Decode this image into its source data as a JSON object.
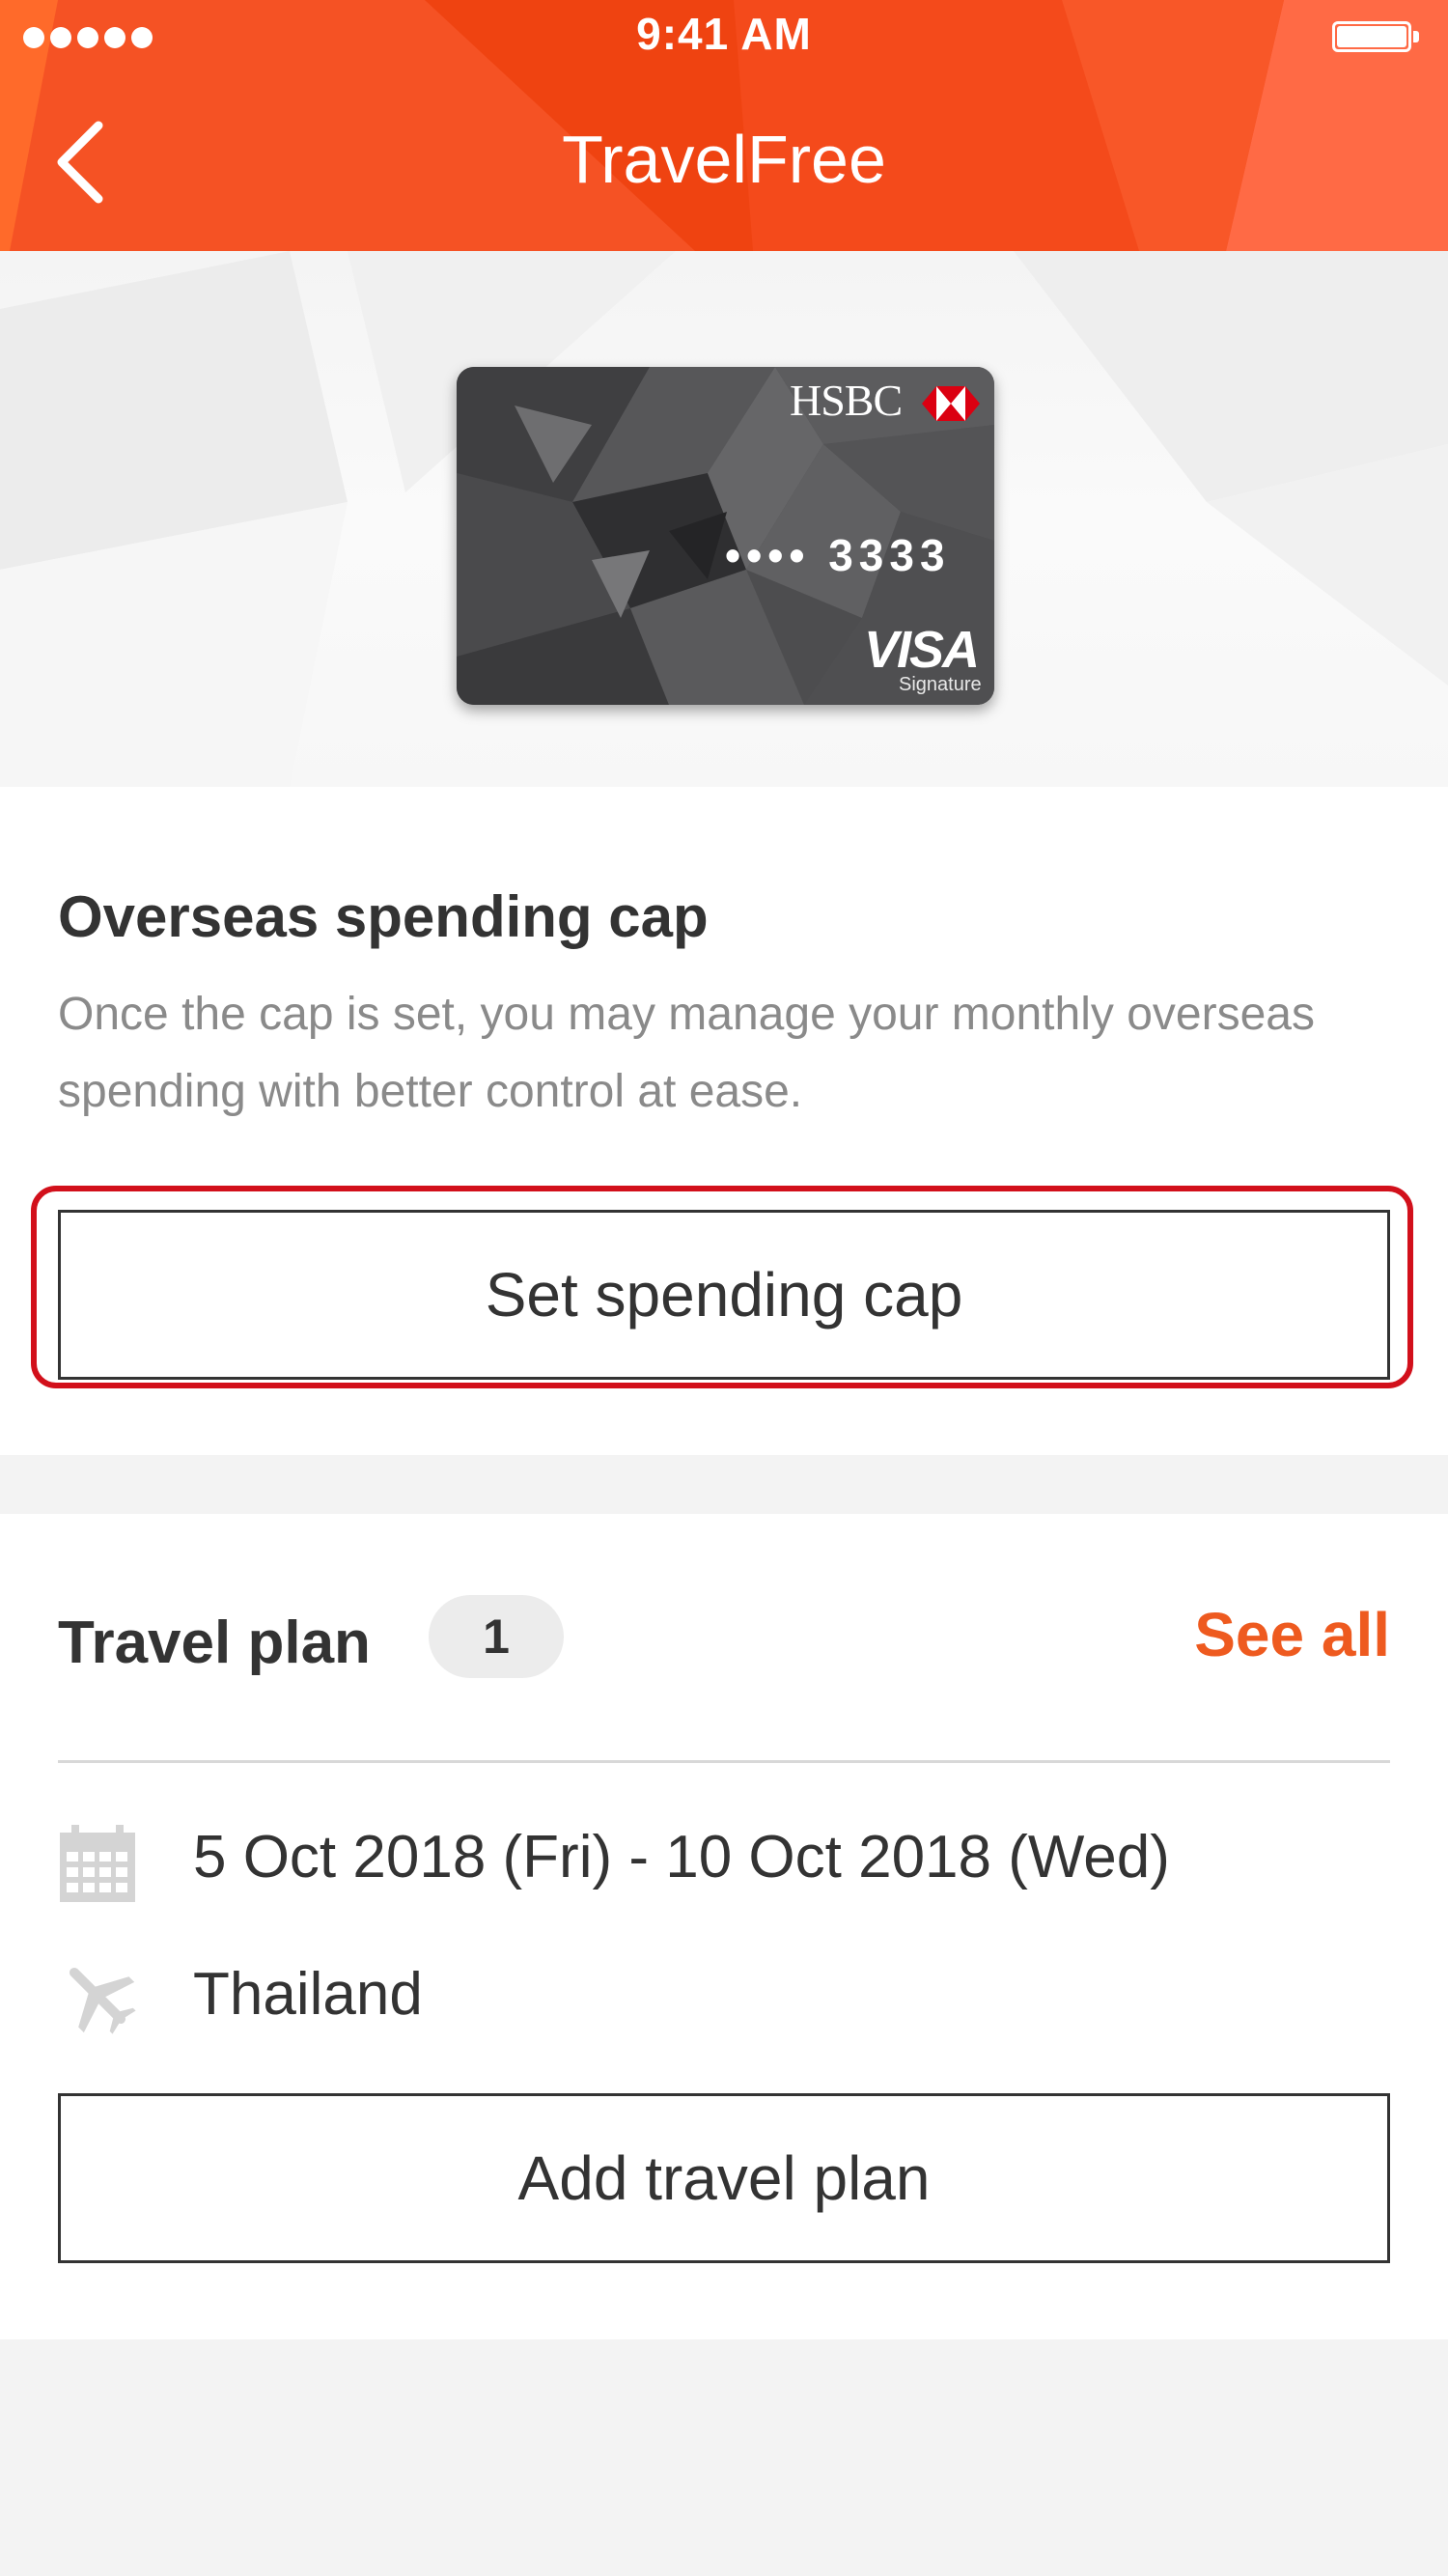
{
  "status_bar": {
    "time": "9:41 AM"
  },
  "nav": {
    "title": "TravelFree"
  },
  "card": {
    "brand": "HSBC",
    "masked_number": "•••• 3333",
    "network": "VISA",
    "tier": "Signature"
  },
  "spending_cap": {
    "title": "Overseas spending cap",
    "description": "Once the cap is set, you may manage your monthly overseas spending with better control at ease.",
    "button_label": "Set spending cap"
  },
  "travel_plan": {
    "title": "Travel plan",
    "count": "1",
    "see_all_label": "See all",
    "dates": "5 Oct 2018 (Fri) - 10 Oct 2018 (Wed)",
    "destination": "Thailand",
    "add_button_label": "Add travel plan"
  },
  "colors": {
    "header": "#f44a1b",
    "accent": "#ee5a1f",
    "highlight_border": "#d2101b"
  }
}
